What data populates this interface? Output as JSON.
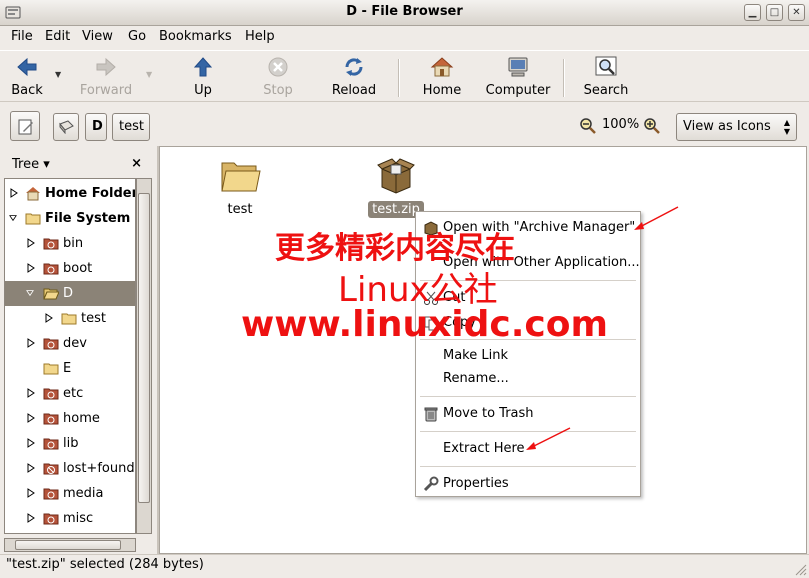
{
  "window": {
    "title": "D - File Browser",
    "controls": [
      "minimize",
      "maximize",
      "close"
    ]
  },
  "menubar": {
    "items": [
      {
        "label": "File"
      },
      {
        "label": "Edit"
      },
      {
        "label": "View"
      },
      {
        "label": "Go"
      },
      {
        "label": "Bookmarks"
      },
      {
        "label": "Help"
      }
    ]
  },
  "toolbar": {
    "back": "Back",
    "forward": "Forward",
    "up": "Up",
    "stop": "Stop",
    "reload": "Reload",
    "home": "Home",
    "computer": "Computer",
    "search": "Search"
  },
  "location": {
    "crumbs": [
      {
        "label": "D"
      },
      {
        "label": "test"
      }
    ],
    "zoom": "100%",
    "view_select": "View as Icons"
  },
  "sidebar": {
    "header": "Tree",
    "items": [
      {
        "label": "Home Folder",
        "bold": true,
        "expanded": false
      },
      {
        "label": "File System",
        "bold": true,
        "expanded": true
      },
      {
        "label": "bin"
      },
      {
        "label": "boot"
      },
      {
        "label": "D",
        "selected": true,
        "expanded": true
      },
      {
        "label": "test"
      },
      {
        "label": "dev"
      },
      {
        "label": "E"
      },
      {
        "label": "etc"
      },
      {
        "label": "home"
      },
      {
        "label": "lib"
      },
      {
        "label": "lost+found"
      },
      {
        "label": "media"
      },
      {
        "label": "misc"
      }
    ]
  },
  "files": [
    {
      "name": "test",
      "type": "folder"
    },
    {
      "name": "test.zip",
      "type": "archive",
      "selected": true
    }
  ],
  "context_menu": {
    "items": [
      {
        "label": "Open with \"Archive Manager\"",
        "icon": "archive-icon"
      },
      {
        "label": "Open with Other Application..."
      },
      {
        "label": "Cut",
        "icon": "cut-icon"
      },
      {
        "label": "Copy",
        "icon": "copy-icon"
      },
      {
        "label": "Make Link"
      },
      {
        "label": "Rename..."
      },
      {
        "label": "Move to Trash",
        "icon": "trash-icon"
      },
      {
        "label": "Extract Here"
      },
      {
        "label": "Properties",
        "icon": "wrench-icon"
      }
    ]
  },
  "status": {
    "text": "\"test.zip\" selected (284 bytes)"
  },
  "watermark": {
    "line1": "更多精彩内容尽在",
    "line2": "Linux公社",
    "line3": "www.linuxidc.com",
    "color": "#ee1111"
  },
  "colors": {
    "selection": "#8b8377",
    "window_bg": "#efebe7",
    "annotation_red": "#ee1111"
  }
}
